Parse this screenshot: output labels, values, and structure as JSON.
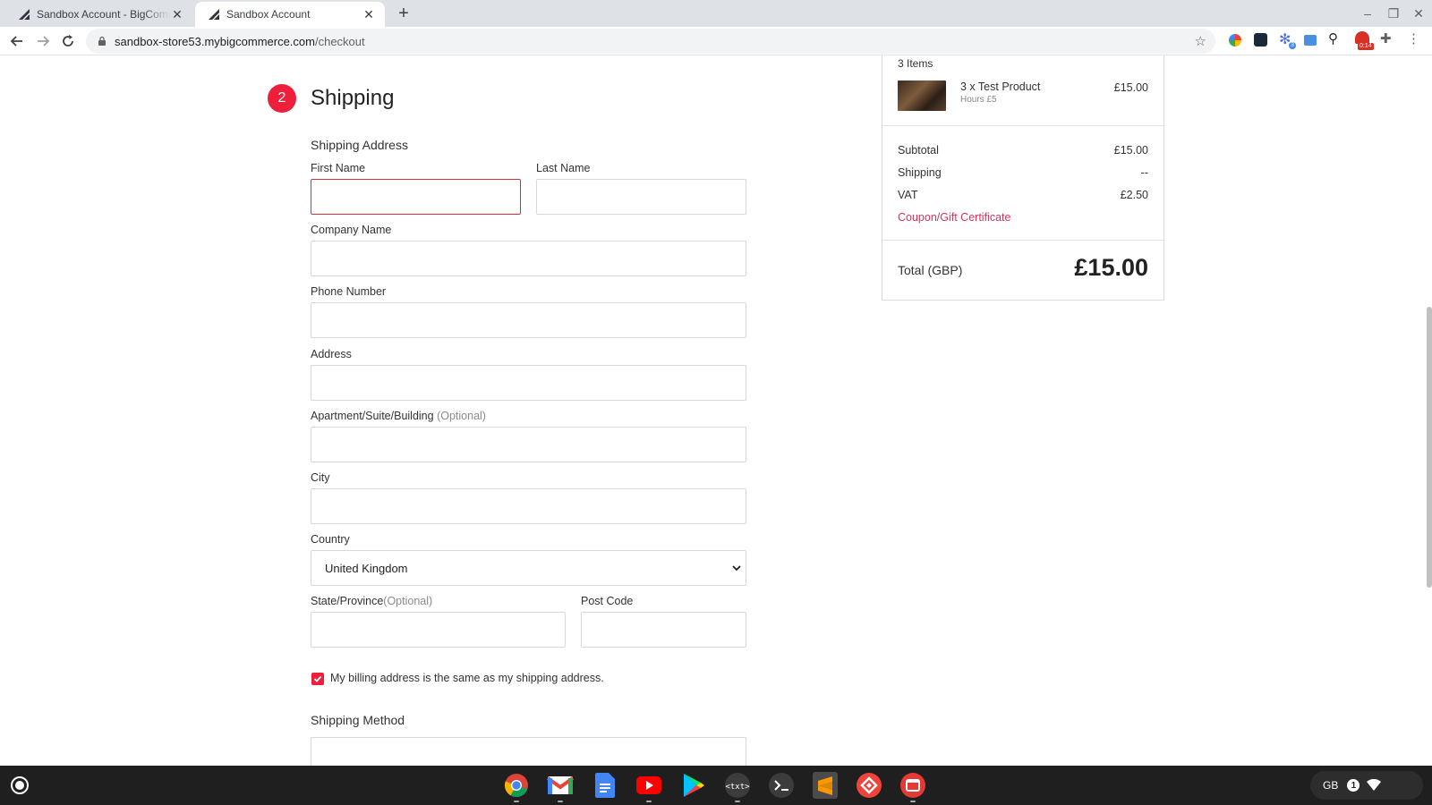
{
  "browser": {
    "tabs": [
      {
        "title": "Sandbox Account - BigCommerce",
        "active": false
      },
      {
        "title": "Sandbox Account",
        "active": true
      }
    ],
    "url_host": "sandbox-store53.mybigcommerce.com",
    "url_path": "/checkout"
  },
  "checkout": {
    "step_number": "2",
    "step_title": "Shipping",
    "shipping_address_heading": "Shipping Address",
    "labels": {
      "first_name": "First Name",
      "last_name": "Last Name",
      "company_name": "Company Name",
      "phone_number": "Phone Number",
      "address": "Address",
      "apartment": "Apartment/Suite/Building",
      "apartment_optional": "(Optional)",
      "city": "City",
      "country": "Country",
      "state": "State/Province",
      "state_optional": "(Optional)",
      "post_code": "Post Code"
    },
    "values": {
      "first_name": "",
      "last_name": "",
      "company_name": "",
      "phone_number": "",
      "address": "",
      "apartment": "",
      "city": "",
      "country": "United Kingdom",
      "state": "",
      "post_code": ""
    },
    "billing_same_checked": true,
    "billing_same_label": "My billing address is the same as my shipping address.",
    "shipping_method_heading": "Shipping Method"
  },
  "order_summary": {
    "items_count": "3 Items",
    "product_name": "3 x Test Product",
    "product_option": "Hours £5",
    "product_price": "£15.00",
    "subtotal_label": "Subtotal",
    "subtotal_value": "£15.00",
    "shipping_label": "Shipping",
    "shipping_value": "--",
    "vat_label": "VAT",
    "vat_value": "£2.50",
    "coupon_link": "Coupon/Gift Certificate",
    "total_label": "Total (GBP)",
    "total_value": "£15.00"
  },
  "shelf": {
    "apps": [
      "chrome-icon",
      "gmail-icon",
      "docs-icon",
      "youtube-icon",
      "play-store-icon",
      "text-editor-icon",
      "terminal-icon",
      "sublime-icon",
      "anydesk-icon",
      "screen-recorder-icon"
    ],
    "keyboard_layout": "GB",
    "notification_count": "1"
  },
  "colors": {
    "accent": "#ed1f3a",
    "link": "#d6335a",
    "error_border": "#d0303a"
  }
}
